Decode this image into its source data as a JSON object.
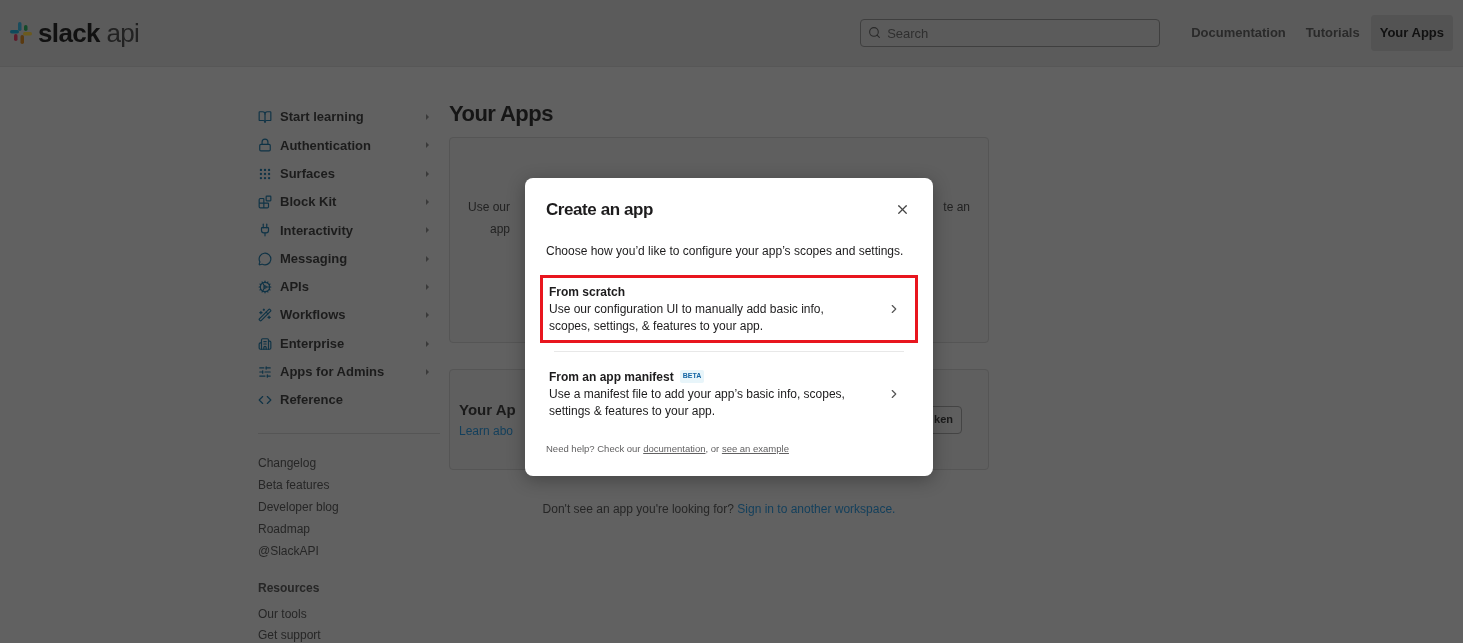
{
  "header": {
    "logo": {
      "brand": "slack",
      "suffix": "api"
    },
    "search": {
      "placeholder": "Search"
    },
    "nav": [
      {
        "label": "Documentation",
        "selected": false
      },
      {
        "label": "Tutorials",
        "selected": false
      },
      {
        "label": "Your Apps",
        "selected": true
      }
    ]
  },
  "sidebar": {
    "items": [
      {
        "label": "Start learning",
        "has_submenu": true
      },
      {
        "label": "Authentication",
        "has_submenu": true
      },
      {
        "label": "Surfaces",
        "has_submenu": true
      },
      {
        "label": "Block Kit",
        "has_submenu": true
      },
      {
        "label": "Interactivity",
        "has_submenu": true
      },
      {
        "label": "Messaging",
        "has_submenu": true
      },
      {
        "label": "APIs",
        "has_submenu": true
      },
      {
        "label": "Workflows",
        "has_submenu": true
      },
      {
        "label": "Enterprise",
        "has_submenu": true
      },
      {
        "label": "Apps for Admins",
        "has_submenu": true
      },
      {
        "label": "Reference",
        "has_submenu": false
      }
    ],
    "links": [
      "Changelog",
      "Beta features",
      "Developer blog",
      "Roadmap",
      "@SlackAPI"
    ],
    "resources": {
      "heading": "Resources",
      "links": [
        "Our tools",
        "Get support"
      ]
    }
  },
  "main": {
    "title": "Your Apps",
    "build_card": {
      "left_fragments": [
        "Use our",
        "app"
      ],
      "right_fragments": [
        "te an"
      ]
    },
    "apps_card": {
      "title_fragment": "Your Ap",
      "link_fragment": "Learn abo",
      "button_fragment": "ken"
    },
    "footer": {
      "text": "Don't see an app you're looking for?",
      "link": "Sign in to another workspace."
    }
  },
  "modal": {
    "title": "Create an app",
    "description": "Choose how you’d like to configure your app’s scopes and settings.",
    "options": [
      {
        "title": "From scratch",
        "description": "Use our configuration UI to manually add basic info, scopes, settings, & features to your app.",
        "highlighted": true
      },
      {
        "title": "From an app manifest",
        "badge": "BETA",
        "description": "Use a manifest file to add your app’s basic info, scopes, settings & features to your app.",
        "highlighted": false
      }
    ],
    "help": [
      {
        "kind": "text",
        "text": "Need help? Check our "
      },
      {
        "kind": "link",
        "text": "documentation"
      },
      {
        "kind": "text",
        "text": ", or "
      },
      {
        "kind": "link",
        "text": "see an example"
      }
    ]
  }
}
